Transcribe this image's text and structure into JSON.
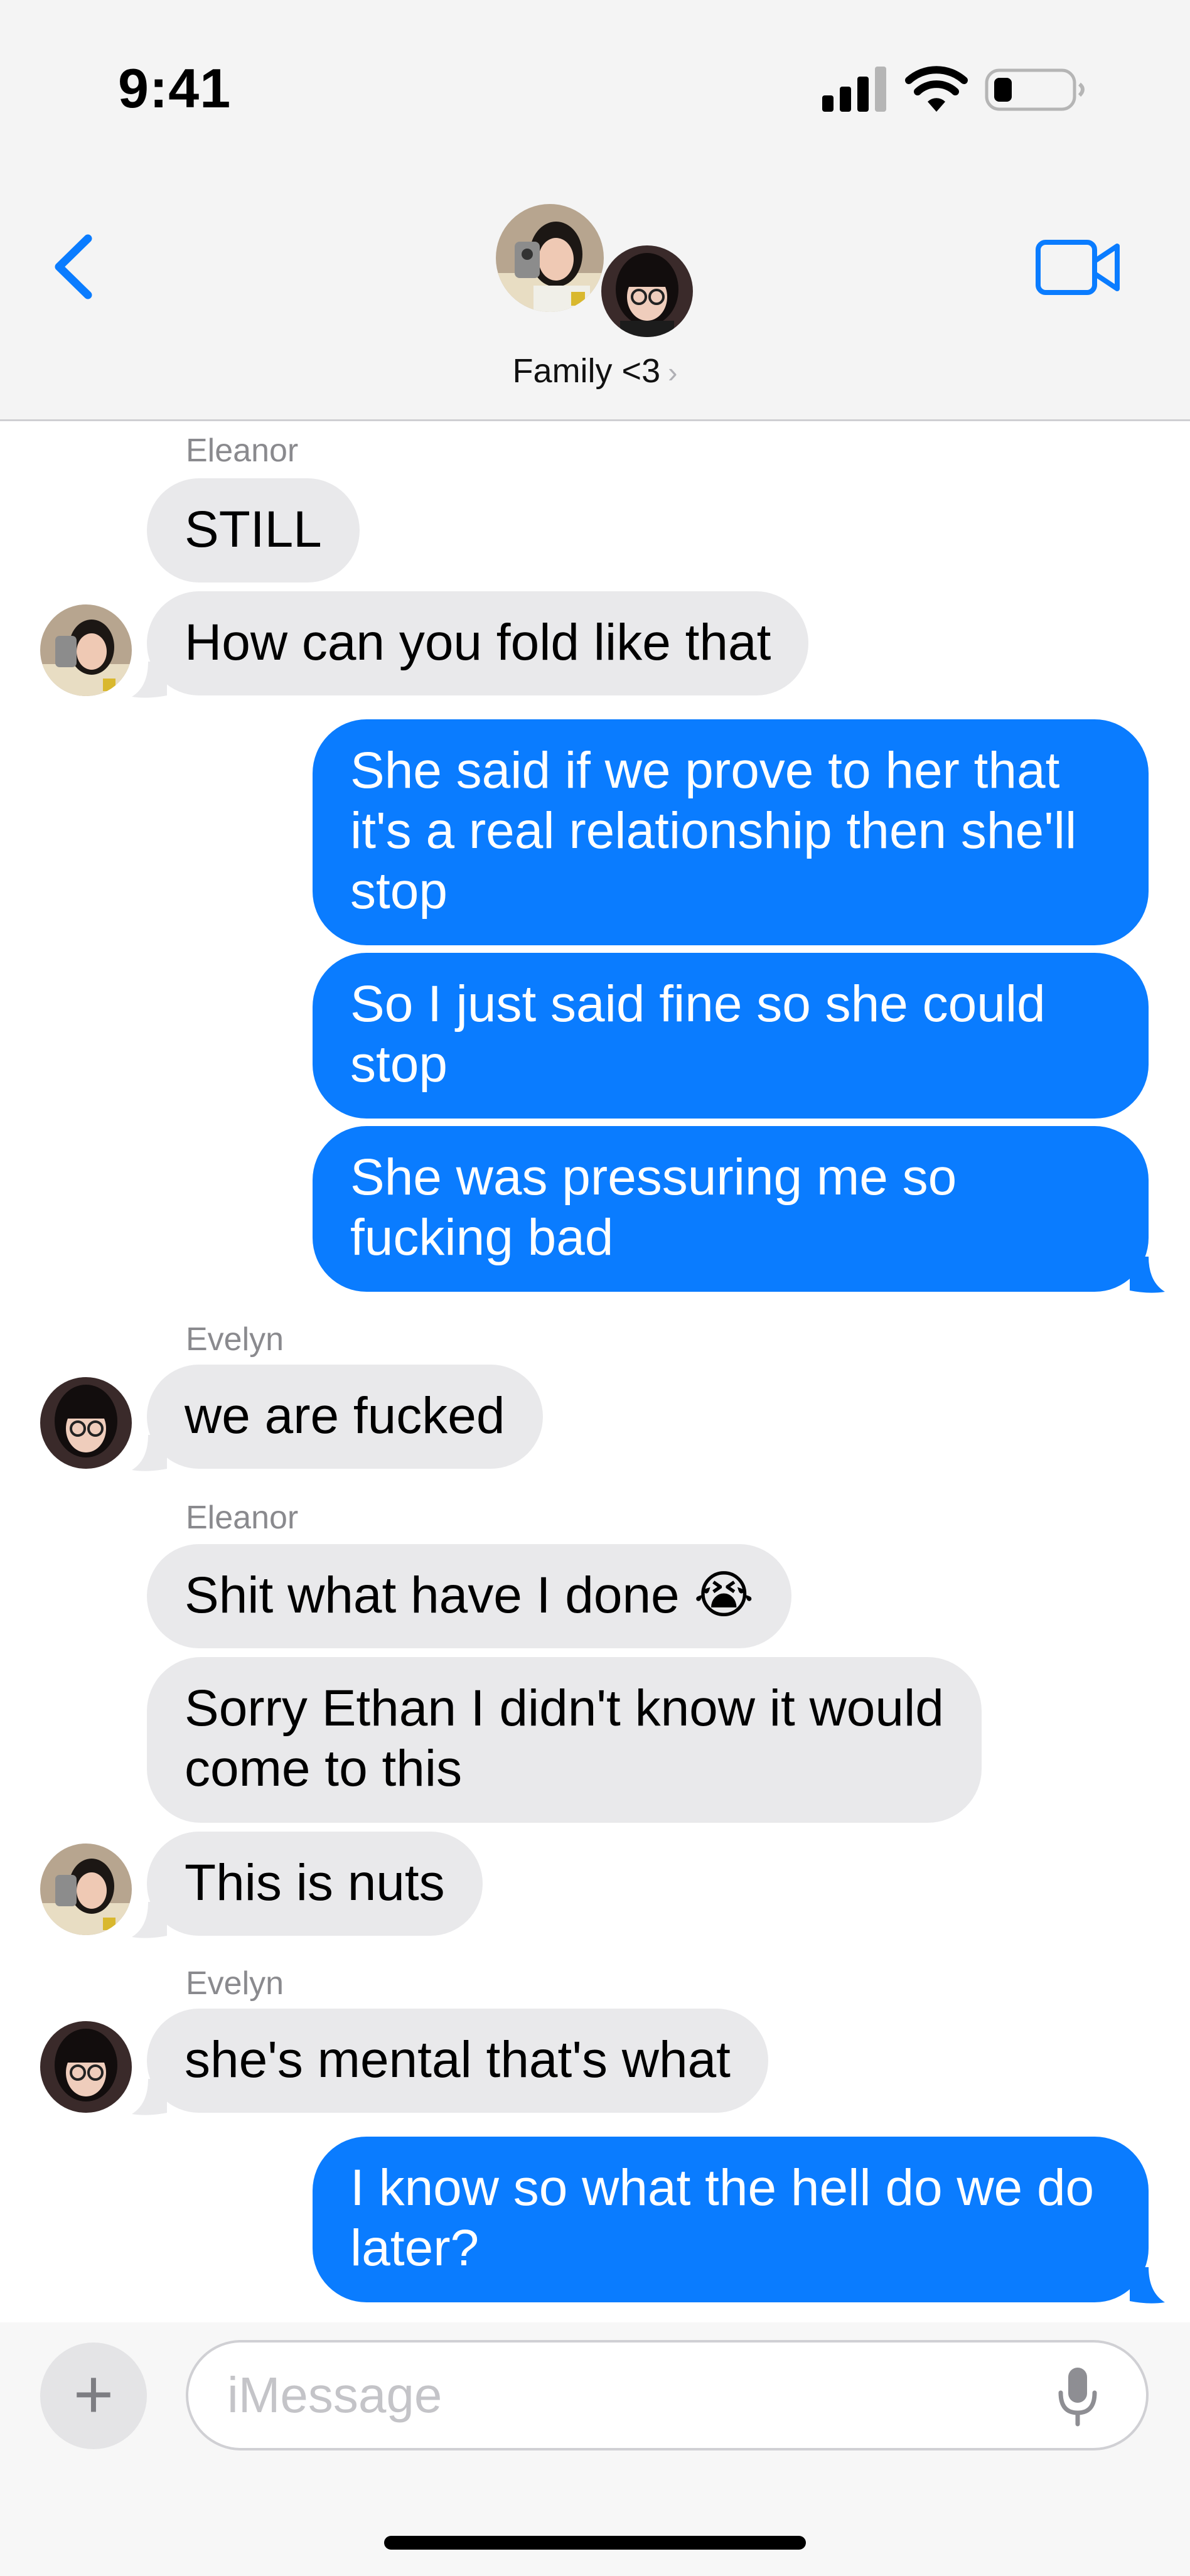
{
  "status_bar": {
    "time": "9:41",
    "signal_icon": "cellular-signal-icon",
    "wifi_icon": "wifi-icon",
    "battery_icon": "battery-icon"
  },
  "header": {
    "back_icon": "chevron-left-icon",
    "group_name": "Family <3",
    "group_chevron": "›",
    "video_icon": "video-camera-icon"
  },
  "messages": [
    {
      "sender": "Eleanor",
      "direction": "incoming",
      "text": "STILL"
    },
    {
      "sender": "Eleanor",
      "direction": "incoming",
      "text": "How can you fold like that"
    },
    {
      "sender": "me",
      "direction": "outgoing",
      "text": "She said if we prove to her that it's a real relationship then she'll stop"
    },
    {
      "sender": "me",
      "direction": "outgoing",
      "text": "So I just said fine so she could stop"
    },
    {
      "sender": "me",
      "direction": "outgoing",
      "text": "She was pressuring me so fucking bad"
    },
    {
      "sender": "Evelyn",
      "direction": "incoming",
      "text": "we are fucked"
    },
    {
      "sender": "Eleanor",
      "direction": "incoming",
      "text": "Shit what have I done 😭"
    },
    {
      "sender": "Eleanor",
      "direction": "incoming",
      "text": "Sorry Ethan I didn't know it would come to this"
    },
    {
      "sender": "Eleanor",
      "direction": "incoming",
      "text": "This is nuts"
    },
    {
      "sender": "Evelyn",
      "direction": "incoming",
      "text": "she's mental that's what"
    },
    {
      "sender": "me",
      "direction": "outgoing",
      "text": "I know so what the hell do we do later?"
    }
  ],
  "sender_labels": {
    "eleanor_1": "Eleanor",
    "evelyn_1": "Evelyn",
    "eleanor_2": "Eleanor",
    "evelyn_2": "Evelyn"
  },
  "composer": {
    "plus_label": "+",
    "placeholder": "iMessage",
    "mic_icon": "microphone-icon"
  },
  "colors": {
    "outgoing_bubble": "#0a7cff",
    "incoming_bubble": "#e9e9eb",
    "accent": "#0a7cff"
  }
}
